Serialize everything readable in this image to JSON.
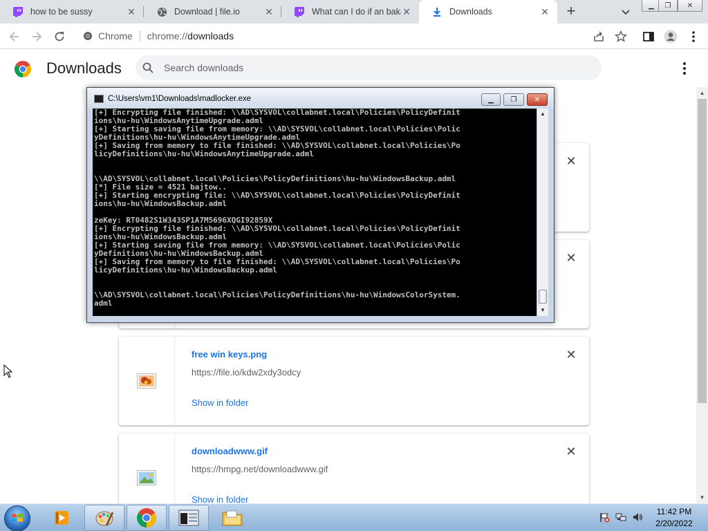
{
  "tabs": [
    {
      "title": "how to be sussy",
      "icon": "twitch-icon",
      "active": false
    },
    {
      "title": "Download | file.io",
      "icon": "globe-icon",
      "active": false
    },
    {
      "title": "What can I do if an baka",
      "icon": "twitch-icon",
      "active": false
    },
    {
      "title": "Downloads",
      "icon": "download-icon",
      "active": true
    }
  ],
  "tab_close_glyph": "✕",
  "new_tab_glyph": "+",
  "window_controls": {
    "minimize": "▁",
    "restore": "❐",
    "close": "✕"
  },
  "omnibox": {
    "site_label": "Chrome",
    "url_prefix": "chrome://",
    "url_path": "downloads"
  },
  "downloads_page": {
    "title": "Downloads",
    "search_placeholder": "Search downloads"
  },
  "download_items": [
    {
      "filename": "",
      "url": "",
      "action": "",
      "close": "✕"
    },
    {
      "filename": "",
      "url": "",
      "action": "",
      "close": "✕"
    },
    {
      "filename": "free win keys.png",
      "url": "https://file.io/kdw2xdy3odcy",
      "action": "Show in folder",
      "close": "✕"
    },
    {
      "filename": "downloadwww.gif",
      "url": "https://hmpg.net/downloadwww.gif",
      "action": "Show in folder",
      "close": "✕"
    }
  ],
  "console_window": {
    "title": "C:\\Users\\vm1\\Downloads\\madlocker.exe",
    "lines": [
      "[+] Encrypting file finished: \\\\AD\\SYSVOL\\collabnet.local\\Policies\\PolicyDefinit",
      "ions\\hu-hu\\WindowsAnytimeUpgrade.adml",
      "[+] Starting saving file from memory: \\\\AD\\SYSVOL\\collabnet.local\\Policies\\Polic",
      "yDefinitions\\hu-hu\\WindowsAnytimeUpgrade.adml",
      "[+] Saving from memory to file finished: \\\\AD\\SYSVOL\\collabnet.local\\Policies\\Po",
      "licyDefinitions\\hu-hu\\WindowsAnytimeUpgrade.adml",
      "",
      "",
      "\\\\AD\\SYSVOL\\collabnet.local\\Policies\\PolicyDefinitions\\hu-hu\\WindowsBackup.adml",
      "[*] File size = 4521 bajtow..",
      "[+] Starting encrypting file: \\\\AD\\SYSVOL\\collabnet.local\\Policies\\PolicyDefinit",
      "ions\\hu-hu\\WindowsBackup.adml",
      "",
      "zeKey: RT0482S1W343SP1A7M5696XQGI92859X",
      "[+] Encrypting file finished: \\\\AD\\SYSVOL\\collabnet.local\\Policies\\PolicyDefinit",
      "ions\\hu-hu\\WindowsBackup.adml",
      "[+] Starting saving file from memory: \\\\AD\\SYSVOL\\collabnet.local\\Policies\\Polic",
      "yDefinitions\\hu-hu\\WindowsBackup.adml",
      "[+] Saving from memory to file finished: \\\\AD\\SYSVOL\\collabnet.local\\Policies\\Po",
      "licyDefinitions\\hu-hu\\WindowsBackup.adml",
      "",
      "",
      "\\\\AD\\SYSVOL\\collabnet.local\\Policies\\PolicyDefinitions\\hu-hu\\WindowsColorSystem.",
      "adml"
    ]
  },
  "taskbar": {
    "apps": [
      {
        "name": "media-player-icon",
        "running": false
      },
      {
        "name": "paint-icon",
        "running": true
      },
      {
        "name": "chrome-icon",
        "running": true
      },
      {
        "name": "console-icon",
        "running": true
      },
      {
        "name": "explorer-folder-icon",
        "running": false
      }
    ],
    "clock_time": "11:42 PM",
    "clock_date": "2/20/2022"
  },
  "colors": {
    "accent": "#1a73e8",
    "console_bg": "#000000",
    "console_text": "#c0c0c0"
  }
}
